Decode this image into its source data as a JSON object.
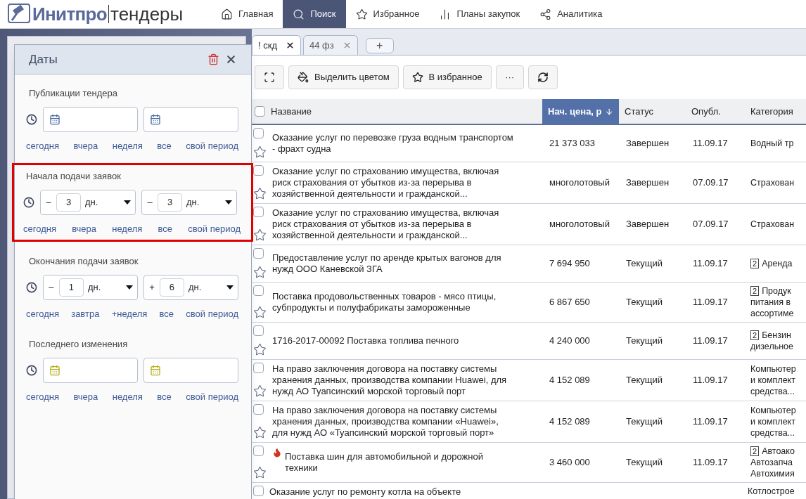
{
  "logo": {
    "brand": "Инитпро",
    "product": "тендеры"
  },
  "nav": [
    {
      "label": "Главная",
      "kind": "home",
      "selected": false
    },
    {
      "label": "Поиск",
      "kind": "search",
      "selected": true
    },
    {
      "label": "Избранное",
      "kind": "star",
      "selected": false
    },
    {
      "label": "Планы закупок",
      "kind": "bars",
      "selected": false
    },
    {
      "label": "Аналитика",
      "kind": "nodes",
      "selected": false
    }
  ],
  "date_panel": {
    "title": "Даты",
    "sections": [
      {
        "title": "Публикации тендера",
        "highlighted": false,
        "inputs": [
          {
            "kind": "date",
            "color": "#4a6aa5"
          },
          {
            "kind": "date",
            "color": "#4a6aa5"
          }
        ],
        "links": [
          "сегодня",
          "вчера",
          "неделя",
          "все",
          "свой период"
        ]
      },
      {
        "title": "Начала подачи заявок",
        "highlighted": true,
        "inputs": [
          {
            "kind": "offset",
            "sign": "–",
            "value": "3",
            "unit": "дн."
          },
          {
            "kind": "offset",
            "sign": "–",
            "value": "3",
            "unit": "дн."
          }
        ],
        "links": [
          "сегодня",
          "вчера",
          "неделя",
          "все",
          "свой период"
        ]
      },
      {
        "title": "Окончания подачи заявок",
        "highlighted": false,
        "inputs": [
          {
            "kind": "offset",
            "sign": "–",
            "value": "1",
            "unit": "дн."
          },
          {
            "kind": "offset",
            "sign": "+",
            "value": "6",
            "unit": "дн."
          }
        ],
        "links": [
          "сегодня",
          "завтра",
          "+неделя",
          "все",
          "свой период"
        ]
      },
      {
        "title": "Последнего изменения",
        "highlighted": false,
        "inputs": [
          {
            "kind": "date",
            "color": "#b5ae1e"
          },
          {
            "kind": "date",
            "color": "#b5ae1e"
          }
        ],
        "links": [
          "сегодня",
          "вчера",
          "неделя",
          "все",
          "свой период"
        ]
      }
    ]
  },
  "tabs": [
    {
      "label": "! скд",
      "selected": true
    },
    {
      "label": "44 фз",
      "selected": false
    }
  ],
  "add_tab": "+",
  "toolbar": [
    {
      "kind": "expand"
    },
    {
      "kind": "color",
      "label": "Выделить цветом"
    },
    {
      "kind": "star",
      "label": "В избранное"
    },
    {
      "kind": "more",
      "label": "···"
    },
    {
      "kind": "refresh"
    }
  ],
  "table": {
    "select_all": {
      "checked": false
    },
    "columns": [
      {
        "label": "Название",
        "sorted": false
      },
      {
        "label": "Нач. цена, р",
        "sorted": true
      },
      {
        "label": "Статус",
        "sorted": false
      },
      {
        "label": "Опубл.",
        "sorted": false
      },
      {
        "label": "Категория",
        "sorted": false
      }
    ],
    "rows": [
      {
        "checked": false,
        "starred": false,
        "hot": false,
        "name": "Оказание услуг по перевозке груза водным транспортом\n- фрахт судна",
        "price": "21 373 033",
        "status": "Завершен",
        "date": "11.09.17",
        "category": [
          "Водный тр"
        ]
      },
      {
        "checked": false,
        "starred": false,
        "hot": false,
        "name": "Оказание услуг по страхованию имущества, включая\nриск страхования от убытков из-за перерыва в\nхозяйственной деятельности и гражданской...",
        "price": "многолотовый",
        "status": "Завершен",
        "date": "07.09.17",
        "category": [
          "Страхован"
        ]
      },
      {
        "checked": false,
        "starred": false,
        "hot": false,
        "name": "Оказание услуг по страхованию имущества, включая\nриск страхования от убытков из-за перерыва в\nхозяйственной деятельности и гражданской...",
        "price": "многолотовый",
        "status": "Завершен",
        "date": "07.09.17",
        "category": [
          "Страхован"
        ]
      },
      {
        "checked": false,
        "starred": false,
        "hot": false,
        "name": "Предоставление услуг по аренде крытых вагонов для\nнужд ООО Каневской ЗГА",
        "price": "7 694 950",
        "status": "Текущий",
        "date": "11.09.17",
        "badge": "2",
        "category": [
          "Аренда"
        ]
      },
      {
        "checked": false,
        "starred": false,
        "hot": false,
        "name": "Поставка продовольственных товаров - мясо птицы,\nсубпродукты и полуфабрикаты замороженные",
        "price": "6 867 650",
        "status": "Текущий",
        "date": "11.09.17",
        "badge": "2",
        "category": [
          "Продук",
          "питания в",
          "ассортиме"
        ]
      },
      {
        "checked": false,
        "starred": false,
        "hot": false,
        "name": "1716-2017-00092 Поставка топлива печного",
        "price": "4 240 000",
        "status": "Текущий",
        "date": "11.09.17",
        "badge": "2",
        "category": [
          "Бензин",
          "дизельное"
        ]
      },
      {
        "checked": false,
        "starred": false,
        "hot": false,
        "name": "На право заключения договора на поставку системы\nхранения данных, производства компании Huawei, для\nнужд АО Туапсинский морской торговый порт",
        "price": "4 152 089",
        "status": "Текущий",
        "date": "11.09.17",
        "category": [
          "Компьютер",
          "и комплект",
          "средства..."
        ]
      },
      {
        "checked": false,
        "starred": false,
        "hot": false,
        "name": "На право заключения договора на поставку системы\nхранения данных, производства компании «Huawei»,\nдля нужд АО «Туапсинский морской торговый порт»",
        "price": "4 152 089",
        "status": "Текущий",
        "date": "11.09.17",
        "category": [
          "Компьютер",
          "и комплект",
          "средства..."
        ]
      },
      {
        "checked": false,
        "starred": false,
        "hot": true,
        "name": "Поставка шин для автомобильной и дорожной\nтехники",
        "price": "3 460 000",
        "status": "Текущий",
        "date": "11.09.17",
        "badge": "2",
        "category": [
          "Автоако",
          "Автозапча",
          "Автохимия"
        ]
      },
      {
        "checked": false,
        "hot": false,
        "name": "Оказание услуг по ремонту котла на объекте",
        "category": [
          "Котлострое"
        ]
      }
    ]
  }
}
